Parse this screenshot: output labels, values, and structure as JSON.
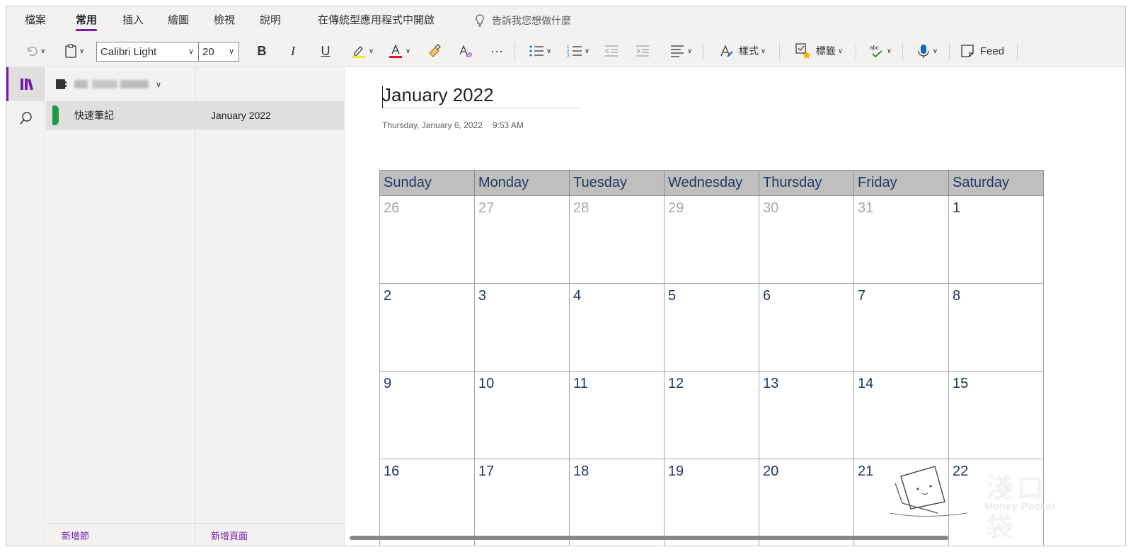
{
  "ribbon": {
    "tabs": [
      "檔案",
      "常用",
      "插入",
      "繪圖",
      "檢視",
      "說明",
      "在傳統型應用程式中開啟"
    ],
    "active_tab": "常用",
    "tell_me": "告訴我您想做什麼",
    "font_name": "Calibri Light",
    "font_size": "20",
    "bold": "B",
    "italic": "I",
    "underline": "U",
    "styles_label": "樣式",
    "tags_label": "標籤",
    "feed_label": "Feed",
    "more": "···"
  },
  "sidebar": {
    "notebook_name_hidden": true
  },
  "sections": {
    "items": [
      {
        "label": "快速筆記",
        "color": "#1e9a45"
      }
    ],
    "add_label": "新增節"
  },
  "pages": {
    "items": [
      {
        "label": "January 2022"
      }
    ],
    "add_label": "新增頁面"
  },
  "page": {
    "title": "January 2022",
    "date": "Thursday, January 6, 2022",
    "time": "9:53 AM"
  },
  "calendar": {
    "headers": [
      "Sunday",
      "Monday",
      "Tuesday",
      "Wednesday",
      "Thursday",
      "Friday",
      "Saturday"
    ],
    "weeks": [
      [
        {
          "d": "26",
          "dim": true
        },
        {
          "d": "27",
          "dim": true
        },
        {
          "d": "28",
          "dim": true
        },
        {
          "d": "29",
          "dim": true
        },
        {
          "d": "30",
          "dim": true
        },
        {
          "d": "31",
          "dim": true
        },
        {
          "d": "1"
        }
      ],
      [
        {
          "d": "2"
        },
        {
          "d": "3"
        },
        {
          "d": "4"
        },
        {
          "d": "5"
        },
        {
          "d": "6"
        },
        {
          "d": "7"
        },
        {
          "d": "8"
        }
      ],
      [
        {
          "d": "9"
        },
        {
          "d": "10"
        },
        {
          "d": "11"
        },
        {
          "d": "12"
        },
        {
          "d": "13"
        },
        {
          "d": "14"
        },
        {
          "d": "15"
        }
      ],
      [
        {
          "d": "16"
        },
        {
          "d": "17"
        },
        {
          "d": "18"
        },
        {
          "d": "19"
        },
        {
          "d": "20"
        },
        {
          "d": "21"
        },
        {
          "d": "22"
        }
      ]
    ]
  },
  "watermark": {
    "title": "淺口袋",
    "subtitle": "Money Pocket"
  },
  "colors": {
    "accent": "#7719aa",
    "header_fill": "#bfbfbf",
    "day_text": "#1f3864",
    "dim_text": "#a6a6a6"
  }
}
